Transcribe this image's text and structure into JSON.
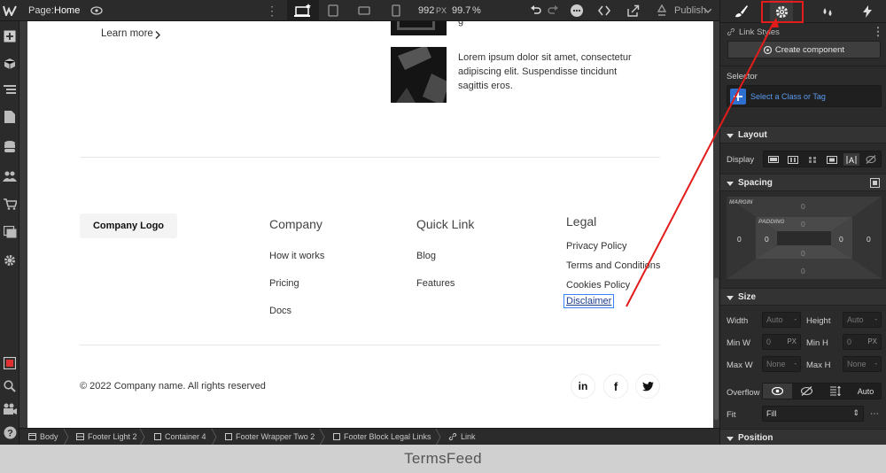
{
  "topbar": {
    "page_label": "Page:",
    "page_name": "Home",
    "width_value": "992",
    "width_unit": "PX",
    "zoom": "99.7",
    "zoom_unit": "%",
    "publish": "Publish"
  },
  "canvas": {
    "learn_more": "Learn more",
    "lorem": [
      "Lorem ipsum dolor sit amet, consectetur",
      "adipiscing elit. Suspendisse tincidunt",
      "sagittis eros."
    ],
    "lorem_top_fragment": "g",
    "logo": "Company Logo",
    "columns": [
      {
        "title": "Company",
        "links": [
          "How it works",
          "Pricing",
          "Docs"
        ]
      },
      {
        "title": "Quick Link",
        "links": [
          "Blog",
          "Features"
        ]
      },
      {
        "title": "Legal",
        "links": [
          "Privacy Policy",
          "Terms and Conditions",
          "Cookies Policy",
          "Disclaimer"
        ]
      }
    ],
    "copyright": "© 2022 Company name. All rights reserved",
    "social": [
      "in",
      "f",
      "twitter"
    ]
  },
  "breadcrumbs": [
    "Body",
    "Footer Light 2",
    "Container 4",
    "Footer Wrapper Two 2",
    "Footer Block Legal Links",
    "Link"
  ],
  "watermark": "TermsFeed",
  "right_panel": {
    "link_styles": "Link Styles",
    "create_component": "Create component",
    "selector_label": "Selector",
    "selector_placeholder": "Select a Class or Tag",
    "layout_title": "Layout",
    "display_label": "Display",
    "spacing_title": "Spacing",
    "margin_label": "MARGIN",
    "padding_label": "PADDING",
    "margin": {
      "top": "0",
      "left": "0",
      "right": "0",
      "bottom": "0"
    },
    "padding": {
      "top": "0",
      "left": "0",
      "right": "0",
      "bottom": "0"
    },
    "size_title": "Size",
    "width_label": "Width",
    "height_label": "Height",
    "width_value": "Auto",
    "height_value": "Auto",
    "minw_label": "Min W",
    "minh_label": "Min H",
    "minw_value": "0",
    "minh_value": "0",
    "min_unit": "PX",
    "maxw_label": "Max W",
    "maxh_label": "Max H",
    "maxw_value": "None",
    "maxh_value": "None",
    "overflow_label": "Overflow",
    "overflow_auto": "Auto",
    "fit_label": "Fit",
    "fit_value": "Fill",
    "position_title": "Position"
  },
  "highlight_color": "#e31c1c"
}
